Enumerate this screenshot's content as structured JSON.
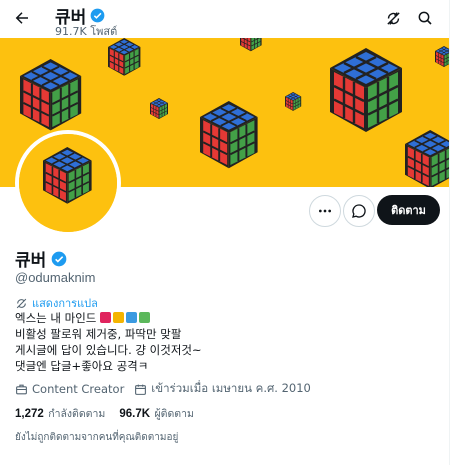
{
  "header": {
    "back_icon": "arrow-left-icon",
    "name": "큐버",
    "post_count": "91.7K โพสต์",
    "refresh_icon": "refresh-off-icon",
    "search_icon": "search-icon"
  },
  "profile": {
    "name": "큐버",
    "handle": "@odumaknim",
    "translate_label": "แสดงการแปล",
    "bio": {
      "line1_prefix": "엑스는 내 마인드",
      "swatch_colors": [
        "#e0245e",
        "#f4b400",
        "#3b9ae1",
        "#5cb85c"
      ],
      "line2": "비활성 팔로워 제거중, 파딱만 맞팔",
      "line3": "게시글에 답이 있습니다. 걍 이것저것~",
      "line4": "댓글엔 답글+좋아요 공격ㅋ"
    },
    "category": "Content Creator",
    "joined": "เข้าร่วมเมื่อ เมษายน ค.ศ. 2010",
    "following_count": "1,272",
    "following_label": "กำลังติดตาม",
    "followers_count": "96.7K",
    "followers_label": "ผู้ติดตาม",
    "not_followed_note": "ยังไม่ถูกติดตามจากคนที่คุณติดตามอยู่"
  },
  "actions": {
    "more_icon": "more-icon",
    "message_icon": "message-icon",
    "follow_label": "ติดตาม"
  },
  "colors": {
    "banner": "#fdc10f",
    "accent": "#1d9bf0",
    "follow_bg": "#0f1419"
  }
}
